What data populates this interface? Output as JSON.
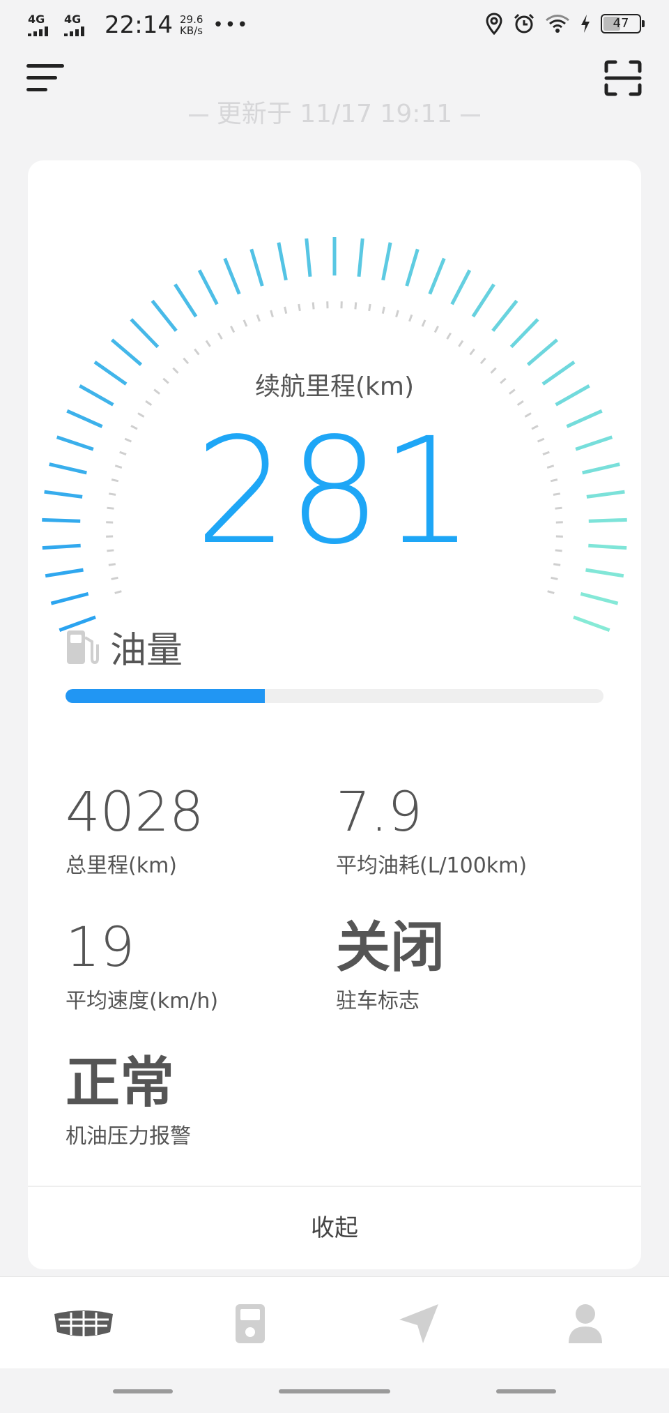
{
  "status_bar": {
    "net1": "4G",
    "net2": "4G",
    "time": "22:14",
    "speed_value": "29.6",
    "speed_unit": "KB/s",
    "more": "•••",
    "battery": "47"
  },
  "header": {
    "updated_text": "更新于 11/17 19:11"
  },
  "gauge": {
    "label": "续航里程(km)",
    "value": "281",
    "colors": {
      "start": "#2aa3f0",
      "end": "#86ead6"
    }
  },
  "fuel": {
    "title": "油量",
    "level": 0.37,
    "fill_color": "#2196f3"
  },
  "stats": [
    {
      "value": "4028",
      "label": "总里程(km)"
    },
    {
      "value": "7.9",
      "label": "平均油耗(L/100km)"
    },
    {
      "value": "19",
      "label": "平均速度(km/h)"
    },
    {
      "value": "关闭",
      "label": "驻车标志"
    },
    {
      "value": "正常",
      "label": "机油压力报警"
    }
  ],
  "collapse_label": "收起",
  "bottom_nav": [
    {
      "icon": "car-grille-icon",
      "active": true
    },
    {
      "icon": "fuel-pump-icon",
      "active": false
    },
    {
      "icon": "navigation-arrow-icon",
      "active": false
    },
    {
      "icon": "person-icon",
      "active": false
    }
  ]
}
